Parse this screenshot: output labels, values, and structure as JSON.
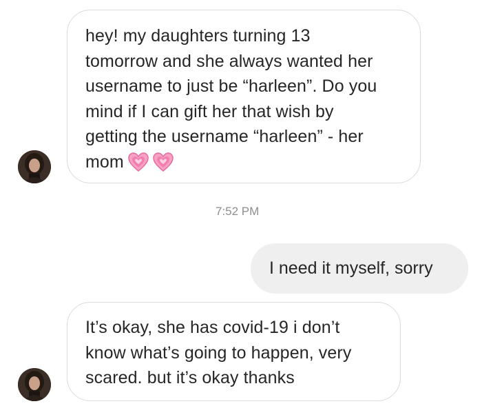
{
  "conversation": {
    "messages": [
      {
        "id": "msg1",
        "direction": "incoming",
        "lines": [
          "hey! my daughters turning 13",
          "tomorrow and she always wanted her",
          "username to just be “harleen”. Do you",
          "mind if I can gift her that wish by",
          "getting the username “harleen” - her",
          "mom"
        ],
        "trailing_emoji": [
          "growing-heart-icon",
          "growing-heart-icon"
        ]
      },
      {
        "id": "timestamp",
        "text": "7:52 PM"
      },
      {
        "id": "msg2",
        "direction": "outgoing",
        "text": "I need it myself, sorry"
      },
      {
        "id": "msg3",
        "direction": "incoming",
        "lines": [
          "It’s okay, she has covid-19 i don’t",
          "know what’s going to happen, very",
          "scared. but it’s okay thanks"
        ]
      }
    ]
  },
  "colors": {
    "incoming_border": "#dbdbdb",
    "outgoing_bg": "#efefef",
    "text": "#262626",
    "timestamp": "#8e8e8e",
    "heart_pink": "#f7a1c4"
  }
}
